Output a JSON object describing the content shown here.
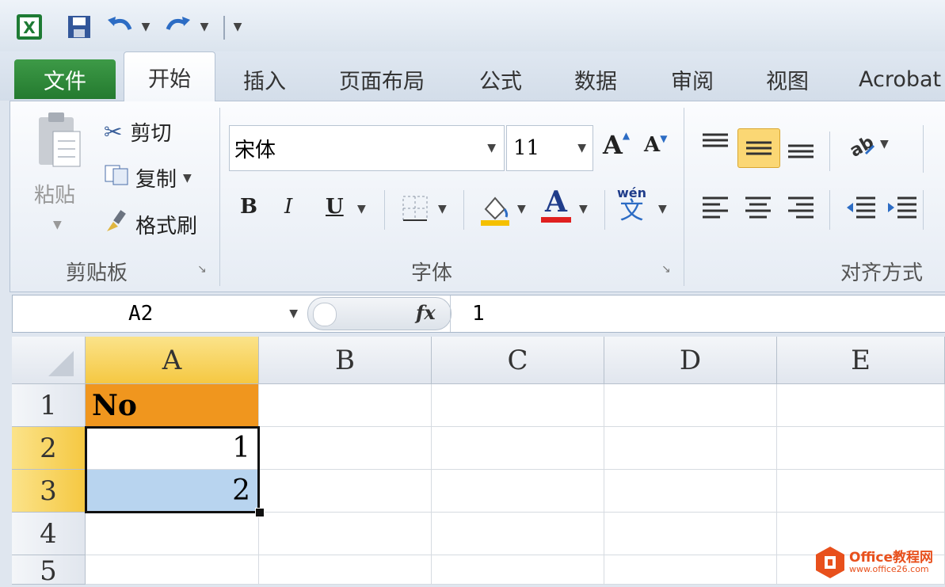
{
  "qat": {
    "icons": [
      "excel-icon",
      "save-icon",
      "undo-icon",
      "redo-icon",
      "customize-icon"
    ]
  },
  "tabs": [
    "文件",
    "开始",
    "插入",
    "页面布局",
    "公式",
    "数据",
    "审阅",
    "视图",
    "Acrobat"
  ],
  "clipboard": {
    "paste": "粘贴",
    "cut": "剪切",
    "copy": "复制",
    "format_painter": "格式刷",
    "label": "剪贴板"
  },
  "font": {
    "name": "宋体",
    "size": "11",
    "label": "字体",
    "grow": "A",
    "shrink": "A",
    "bold": "B",
    "italic": "I",
    "underline": "U",
    "font_color": "A",
    "phonetic_top": "wén",
    "phonetic_bottom": "文"
  },
  "alignment": {
    "label": "对齐方式"
  },
  "formula_bar": {
    "name_box": "A2",
    "fx": "fx",
    "value": "1"
  },
  "sheet": {
    "columns": [
      "A",
      "B",
      "C",
      "D",
      "E"
    ],
    "rows": [
      "1",
      "2",
      "3",
      "4",
      "5"
    ],
    "cells": {
      "A1": "No",
      "A2": "1",
      "A3": "2"
    }
  },
  "watermark": {
    "brand": "Office教程网",
    "url": "www.office26.com"
  },
  "colors": {
    "file_tab": "#2f8a3b",
    "header_fill": "#f0961e",
    "selected_header": "#f5c842",
    "selection": "#b8d4ef",
    "align_active": "#fbd774"
  }
}
